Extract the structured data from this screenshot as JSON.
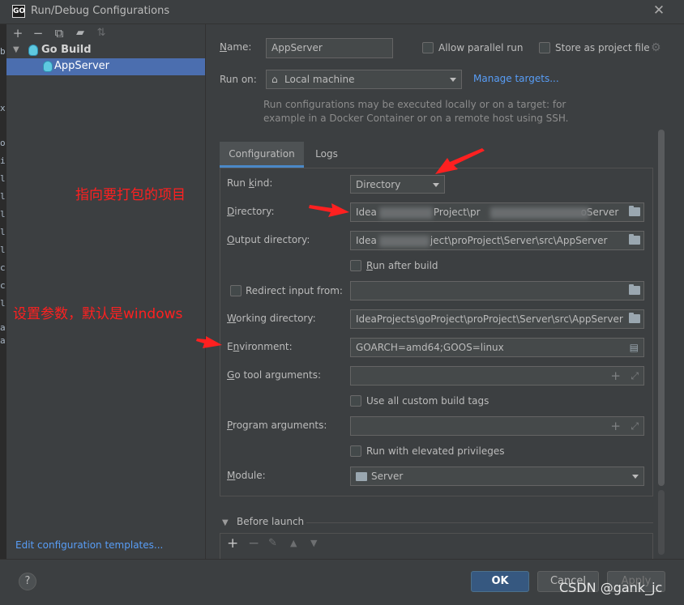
{
  "window": {
    "title": "Run/Debug Configurations",
    "logo": "GO"
  },
  "toolbar": {
    "icons": [
      "add-icon",
      "remove-icon",
      "copy-icon",
      "folder-add-icon",
      "sort-icon"
    ]
  },
  "tree": {
    "group": "Go Build",
    "item": "AppServer"
  },
  "left_footer": {
    "edit_templates": "Edit configuration templates..."
  },
  "editor_sliver": {
    "chars": [
      "b",
      "x",
      "o",
      "i",
      "l",
      "l",
      "l",
      "l",
      "l",
      "c",
      "c",
      "l",
      "a",
      "a"
    ]
  },
  "form": {
    "name_label": "Name:",
    "name_value": "AppServer",
    "allow_parallel": "Allow parallel run",
    "store_project": "Store as project file",
    "run_on_label": "Run on:",
    "run_on_value": "Local machine",
    "manage_targets": "Manage targets...",
    "run_on_hint_1": "Run configurations may be executed locally or on a target: for",
    "run_on_hint_2": "example in a Docker Container or on a remote host using SSH.",
    "tabs": [
      "Configuration",
      "Logs"
    ],
    "run_kind_label": "Run kind:",
    "run_kind_value": "Directory",
    "directory_label": "Directory:",
    "directory_value_a": "Idea",
    "directory_value_b": "Project\\pr",
    "directory_value_c": "oServer",
    "output_dir_label": "Output directory:",
    "output_dir_value_a": "Idea",
    "output_dir_value_b": "ject\\proProject\\Server\\src\\AppServer",
    "run_after_build": "Run after build",
    "redirect_input": "Redirect input from:",
    "working_dir_label": "Working directory:",
    "working_dir_value": "IdeaProjects\\goProject\\proProject\\Server\\src\\AppServer",
    "environment_label": "Environment:",
    "environment_value": "GOARCH=amd64;GOOS=linux",
    "go_tool_args_label": "Go tool arguments:",
    "use_custom_tags": "Use all custom build tags",
    "program_args_label": "Program arguments:",
    "run_elevated": "Run with elevated privileges",
    "module_label": "Module:",
    "module_value": "Server",
    "before_launch": "Before launch"
  },
  "buttons": {
    "help": "?",
    "ok": "OK",
    "cancel": "Cancel",
    "apply": "Apply"
  },
  "annotations": {
    "point_to_project": "指向要打包的项目",
    "set_params": "设置参数，默认是windows"
  },
  "watermark": "CSDN @gank_jc",
  "colors": {
    "accent": "#4b6eaf",
    "link": "#589df6",
    "annotation": "#ff2020",
    "ok_button": "#365880"
  }
}
